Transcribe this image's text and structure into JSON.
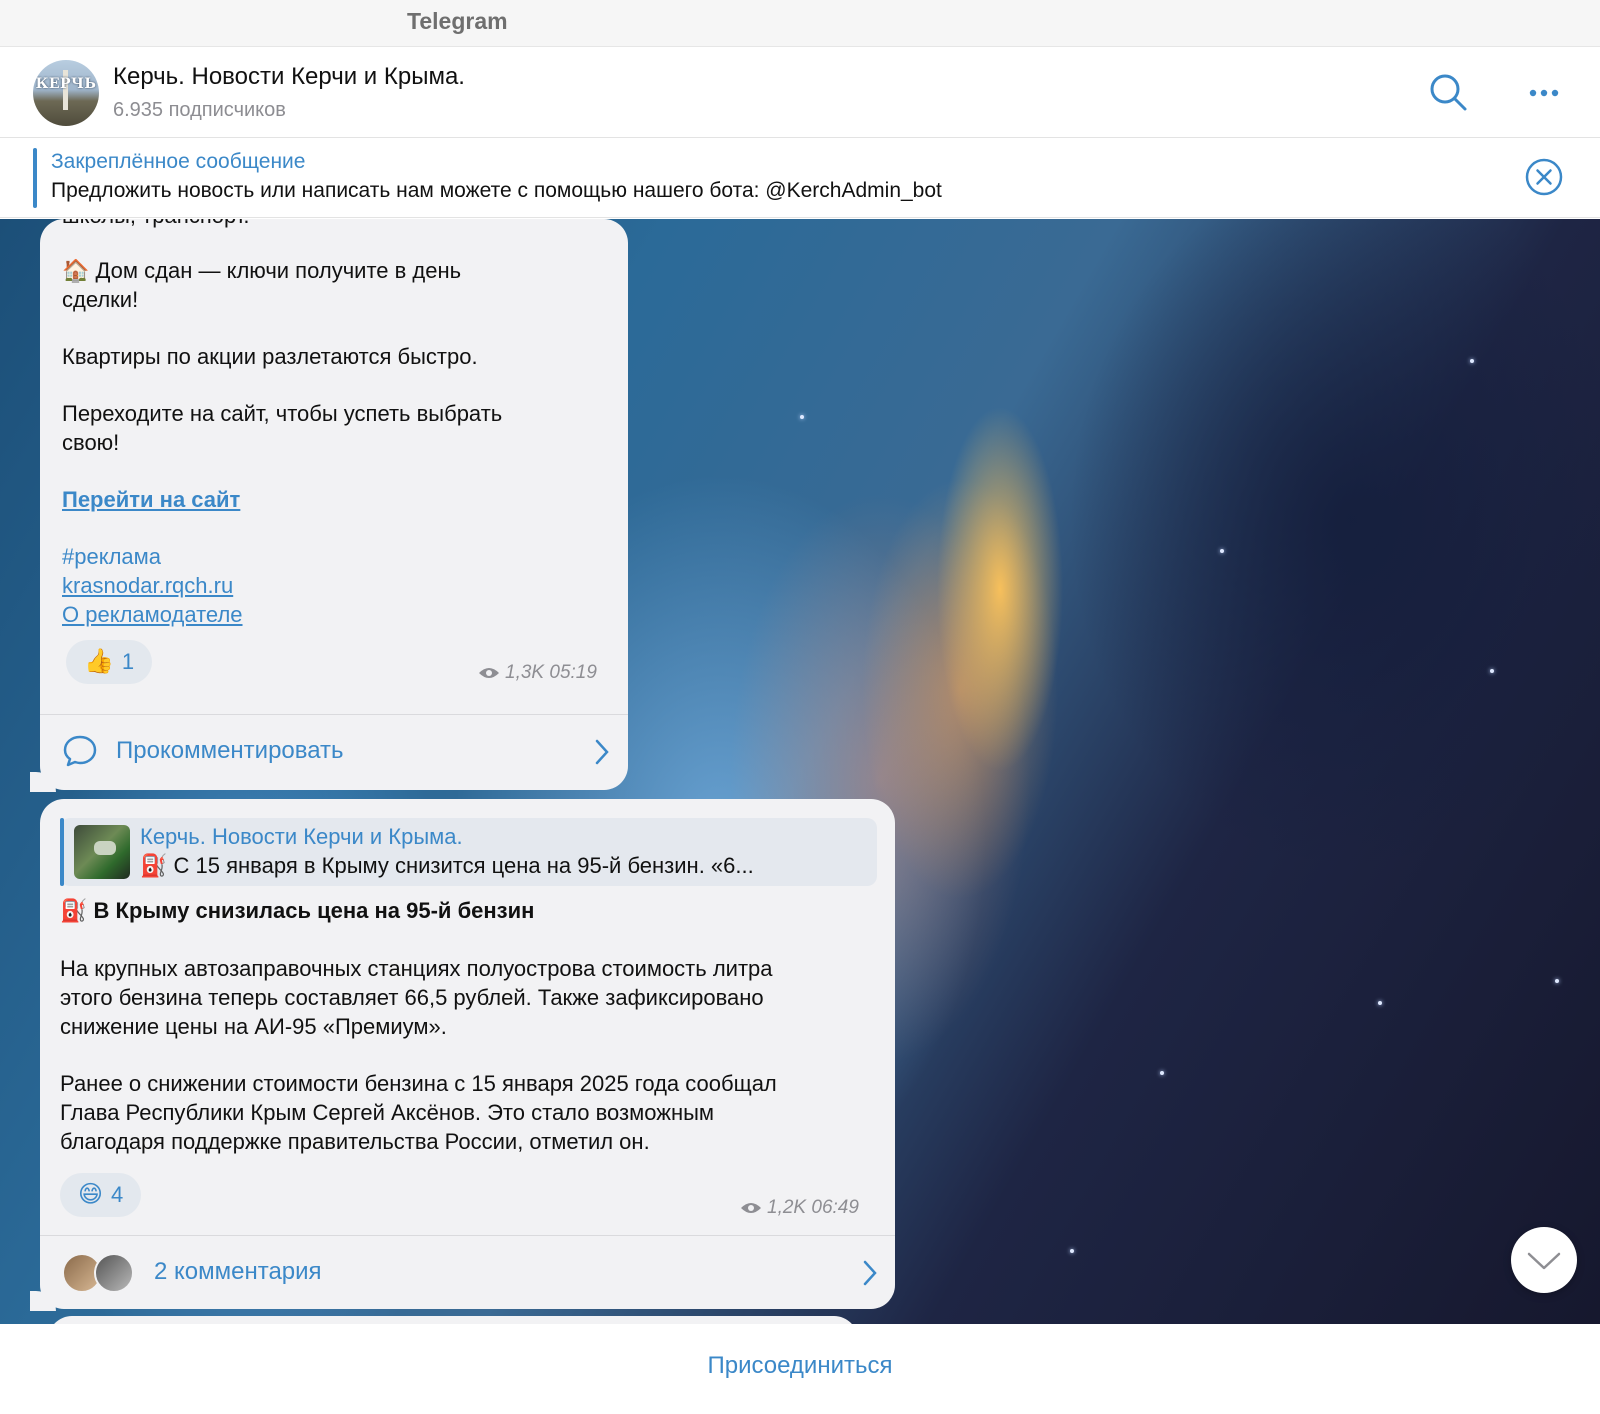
{
  "window": {
    "title": "Telegram"
  },
  "channel": {
    "avatar_text": "КЕРЧЬ",
    "name": "Керчь. Новости Керчи и Крыма.",
    "subscribers": "6.935 подписчиков"
  },
  "header_icons": [
    "search-icon",
    "more-icon"
  ],
  "pinned": {
    "title": "Закреплённое сообщение",
    "text": "Предложить новость или написать нам можете с помощью нашего бота: @KerchAdmin_bot"
  },
  "message1": {
    "clipped_line": "школы, транспорт.",
    "line_house_emoji": "🏠",
    "line_house_1": "Дом сдан — ключи получите в день",
    "line_house_2": "сделки!",
    "line_fast": "Квартиры по акции разлетаются быстро.",
    "line_site_1": "Переходите на сайт, чтобы успеть выбрать",
    "line_site_2": "свою!",
    "link_site": "Перейти на сайт",
    "hashtag": "#реклама",
    "link_domain": "krasnodar.rqch.ru",
    "link_advertiser": "О рекламодателе",
    "reaction_emoji": "👍",
    "reaction_count": "1",
    "views": "1,3K",
    "time": "05:19",
    "comment_label": "Прокомментировать"
  },
  "message2": {
    "forward_title": "Керчь. Новости Керчи и Крыма.",
    "forward_text": "⛽ С 15 января в Крыму снизится цена на 95-й бензин.   «6...",
    "headline_emoji": "⛽",
    "headline": "В Крыму снизилась цена на 95-й бензин",
    "p1_l1": "На крупных автозаправочных станциях полуострова стоимость литра",
    "p1_l2": "этого бензина теперь составляет 66,5 рублей. Также зафиксировано",
    "p1_l3": "снижение цены на АИ-95 «Премиум».",
    "p2_l1": "Ранее о снижении стоимости бензина с 15 января 2025 года сообщал",
    "p2_l2": "Глава Республики Крым Сергей Аксёнов. Это стало возможным",
    "p2_l3": "благодаря поддержке правительства России, отметил он.",
    "reaction_emoji": "😄",
    "reaction_count": "4",
    "views": "1,2K",
    "time": "06:49",
    "comments_label": "2 комментария"
  },
  "bottom": {
    "join_label": "Присоединиться"
  },
  "colors": {
    "accent": "#3b88c8",
    "bubble": "#f2f2f4",
    "meta": "#8e8e93"
  }
}
